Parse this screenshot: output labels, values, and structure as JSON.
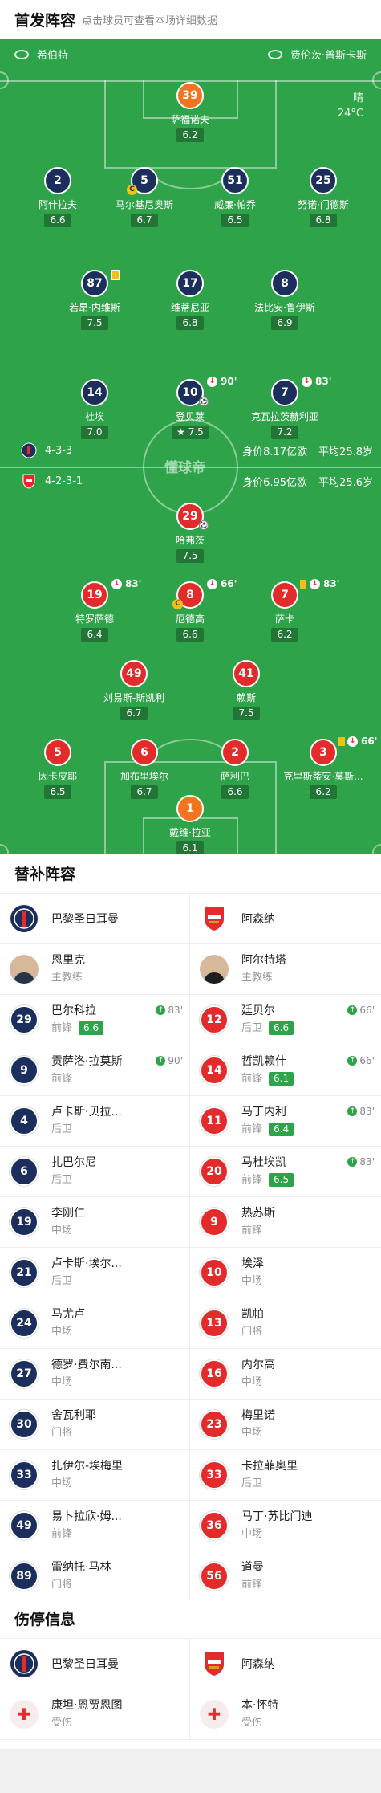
{
  "header": {
    "title": "首发阵容",
    "subtitle": "点击球员可查看本场详细数据"
  },
  "pitch": {
    "home_team": "希伯特",
    "away_team": "费伦茨·普斯卡斯",
    "weather": "晴",
    "temperature": "24°C",
    "watermark": "懂球帝",
    "home_formation": "4-3-3",
    "home_value": "身价8.17亿欧",
    "home_age": "平均25.8岁",
    "away_formation": "4-2-3-1",
    "away_value": "身价6.95亿欧",
    "away_age": "平均25.6岁",
    "colors": {
      "pitch": "#2fa34a",
      "psg": "#1c2f5c",
      "arsenal": "#e32b2b",
      "gk": "#f2741e"
    }
  },
  "psg_players": [
    {
      "num": "39",
      "name": "萨福诺夫",
      "rating": "6.2"
    },
    {
      "num": "2",
      "name": "阿什拉夫",
      "rating": "6.6"
    },
    {
      "num": "5",
      "name": "马尔基尼奥斯",
      "rating": "6.7"
    },
    {
      "num": "51",
      "name": "威廉·帕乔",
      "rating": "6.5"
    },
    {
      "num": "25",
      "name": "努诺·门德斯",
      "rating": "6.8"
    },
    {
      "num": "87",
      "name": "若昂·内维斯",
      "rating": "7.5"
    },
    {
      "num": "17",
      "name": "维蒂尼亚",
      "rating": "6.8"
    },
    {
      "num": "8",
      "name": "法比安·鲁伊斯",
      "rating": "6.9"
    },
    {
      "num": "14",
      "name": "杜埃",
      "rating": "7.0"
    },
    {
      "num": "10",
      "name": "登贝莱",
      "rating": "7.5",
      "sub_time": "90'"
    },
    {
      "num": "7",
      "name": "克瓦拉茨赫利亚",
      "rating": "7.2",
      "sub_time": "83'"
    }
  ],
  "arsenal_players": [
    {
      "num": "29",
      "name": "哈弗茨",
      "rating": "7.5"
    },
    {
      "num": "19",
      "name": "特罗萨德",
      "rating": "6.4",
      "sub_time": "83'"
    },
    {
      "num": "8",
      "name": "厄德高",
      "rating": "6.6",
      "sub_time": "66'"
    },
    {
      "num": "7",
      "name": "萨卡",
      "rating": "6.2",
      "sub_time": "83'"
    },
    {
      "num": "49",
      "name": "刘易斯-斯凯利",
      "rating": "6.7"
    },
    {
      "num": "41",
      "name": "赖斯",
      "rating": "7.5"
    },
    {
      "num": "5",
      "name": "因卡皮耶",
      "rating": "6.5"
    },
    {
      "num": "6",
      "name": "加布里埃尔",
      "rating": "6.7"
    },
    {
      "num": "2",
      "name": "萨利巴",
      "rating": "6.6"
    },
    {
      "num": "3",
      "name": "克里斯蒂安·莫斯...",
      "rating": "6.2",
      "sub_time": "66'"
    },
    {
      "num": "1",
      "name": "戴维·拉亚",
      "rating": "6.1"
    }
  ],
  "subs": {
    "title": "替补阵容",
    "psg_team": "巴黎圣日耳曼",
    "ars_team": "阿森纳",
    "psg_coach": {
      "name": "恩里克",
      "role": "主教练"
    },
    "ars_coach": {
      "name": "阿尔特塔",
      "role": "主教练"
    },
    "psg": [
      {
        "num": "29",
        "name": "巴尔科拉",
        "pos": "前锋",
        "rating": "6.6",
        "time": "83'"
      },
      {
        "num": "9",
        "name": "贡萨洛·拉莫斯",
        "pos": "前锋",
        "time": "90'"
      },
      {
        "num": "4",
        "name": "卢卡斯·贝拉...",
        "pos": "后卫"
      },
      {
        "num": "6",
        "name": "扎巴尔尼",
        "pos": "后卫"
      },
      {
        "num": "19",
        "name": "李刚仁",
        "pos": "中场"
      },
      {
        "num": "21",
        "name": "卢卡斯·埃尔...",
        "pos": "后卫"
      },
      {
        "num": "24",
        "name": "马尤卢",
        "pos": "中场"
      },
      {
        "num": "27",
        "name": "德罗·费尔南...",
        "pos": "中场"
      },
      {
        "num": "30",
        "name": "舍瓦利耶",
        "pos": "门将"
      },
      {
        "num": "33",
        "name": "扎伊尔-埃梅里",
        "pos": "中场"
      },
      {
        "num": "49",
        "name": "易卜拉欣·姆...",
        "pos": "前锋"
      },
      {
        "num": "89",
        "name": "雷纳托·马林",
        "pos": "门将"
      }
    ],
    "ars": [
      {
        "num": "12",
        "name": "廷贝尔",
        "pos": "后卫",
        "rating": "6.6",
        "time": "66'"
      },
      {
        "num": "14",
        "name": "哲凯赖什",
        "pos": "前锋",
        "rating": "6.1",
        "time": "66'"
      },
      {
        "num": "11",
        "name": "马丁内利",
        "pos": "前锋",
        "rating": "6.4",
        "time": "83'"
      },
      {
        "num": "20",
        "name": "马杜埃凯",
        "pos": "前锋",
        "rating": "6.5",
        "time": "83'"
      },
      {
        "num": "9",
        "name": "热苏斯",
        "pos": "前锋"
      },
      {
        "num": "10",
        "name": "埃泽",
        "pos": "中场"
      },
      {
        "num": "13",
        "name": "凯帕",
        "pos": "门将"
      },
      {
        "num": "16",
        "name": "内尔高",
        "pos": "中场"
      },
      {
        "num": "23",
        "name": "梅里诺",
        "pos": "中场"
      },
      {
        "num": "33",
        "name": "卡拉菲奥里",
        "pos": "后卫"
      },
      {
        "num": "36",
        "name": "马丁·苏比门迪",
        "pos": "中场"
      },
      {
        "num": "56",
        "name": "道曼",
        "pos": "前锋"
      }
    ]
  },
  "injuries": {
    "title": "伤停信息",
    "psg_team": "巴黎圣日耳曼",
    "ars_team": "阿森纳",
    "psg": {
      "name": "康坦·恩贾恩图",
      "status": "受伤"
    },
    "ars": {
      "name": "本·怀特",
      "status": "受伤"
    }
  }
}
